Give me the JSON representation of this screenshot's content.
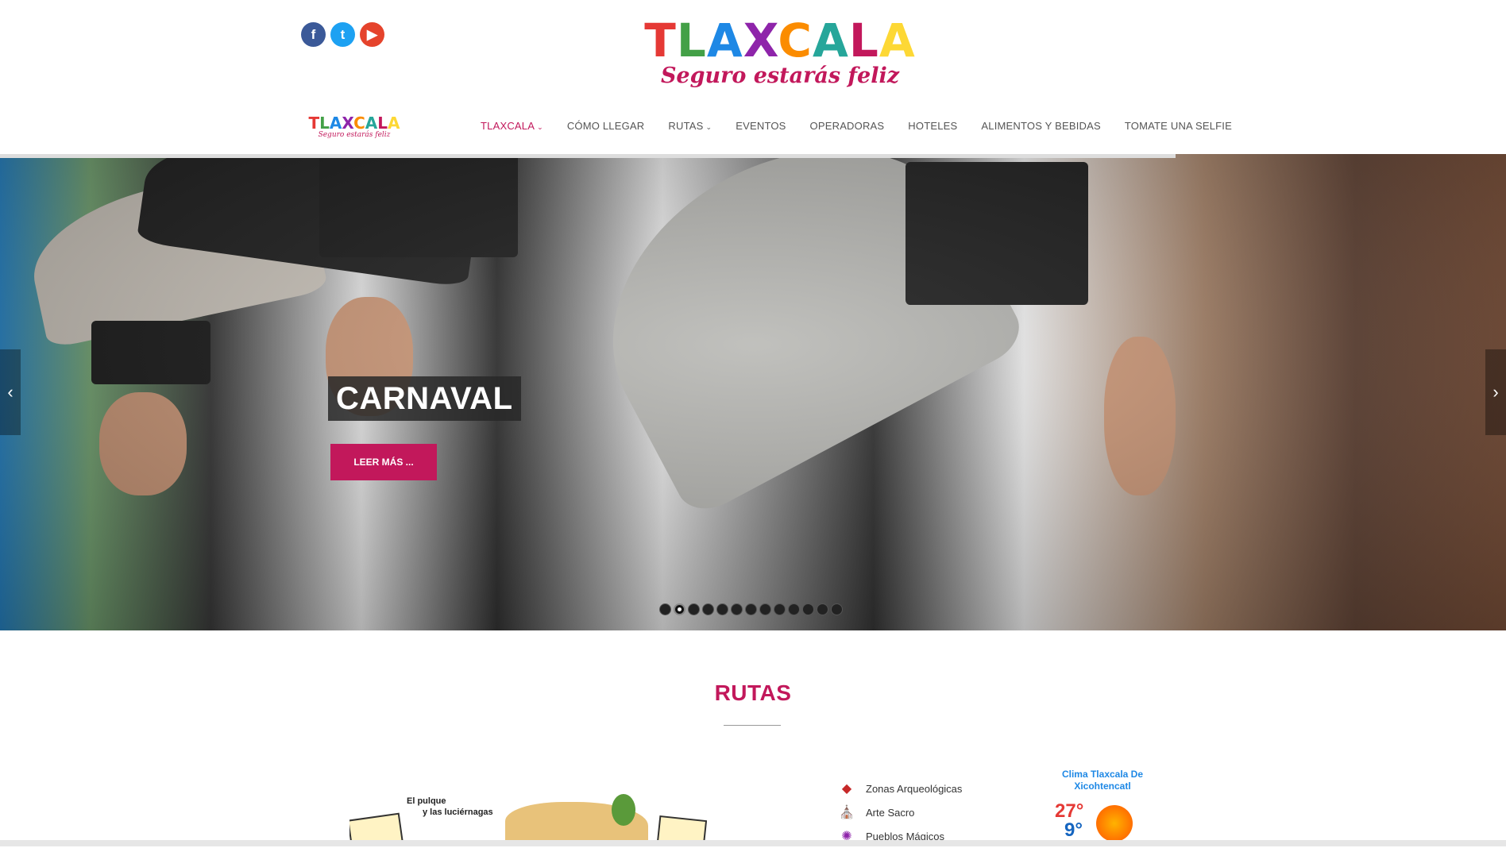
{
  "header": {
    "logo_word": "TLAXCALA",
    "logo_tagline": "Seguro estarás feliz",
    "social": [
      {
        "name": "facebook",
        "glyph": "f",
        "color": "#3b5998"
      },
      {
        "name": "twitter",
        "glyph": "t",
        "color": "#1da1f2"
      },
      {
        "name": "youtube",
        "glyph": "▶",
        "color": "#e5432c"
      }
    ]
  },
  "nav": {
    "logo_word": "TLAXCALA",
    "logo_tagline": "Seguro estarás feliz",
    "items": [
      {
        "label": "TLAXCALA",
        "active": true,
        "dropdown": true
      },
      {
        "label": "CÓMO LLEGAR"
      },
      {
        "label": "RUTAS",
        "dropdown": true
      },
      {
        "label": "EVENTOS"
      },
      {
        "label": "OPERADORAS"
      },
      {
        "label": "HOTELES"
      },
      {
        "label": "ALIMENTOS Y BEBIDAS"
      },
      {
        "label": "TOMATE UNA SELFIE"
      }
    ]
  },
  "slider": {
    "caption": "CARNAVAL",
    "button_label": "LEER MÁS ...",
    "dot_count": 13,
    "active_dot": 2,
    "prev_glyph": "‹",
    "next_glyph": "›"
  },
  "rutas": {
    "title": "RUTAS",
    "map_label_1": "El pulque",
    "map_label_2": "y las luciérnagas",
    "legend": [
      {
        "label": "Zonas Arqueológicas",
        "icon": "pyramid-icon"
      },
      {
        "label": "Arte Sacro",
        "icon": "church-icon"
      },
      {
        "label": "Pueblos Mágicos",
        "icon": "magic-town-icon"
      }
    ]
  },
  "weather": {
    "title": "Clima Tlaxcala De Xicohtencatl",
    "high": "27°",
    "low": "9°"
  },
  "colors": {
    "brand": "#c2185b",
    "logo_letters": [
      "#e53935",
      "#43a047",
      "#1e88e5",
      "#8e24aa",
      "#fb8c00",
      "#26a69a",
      "#c2185b",
      "#fdd835"
    ]
  }
}
